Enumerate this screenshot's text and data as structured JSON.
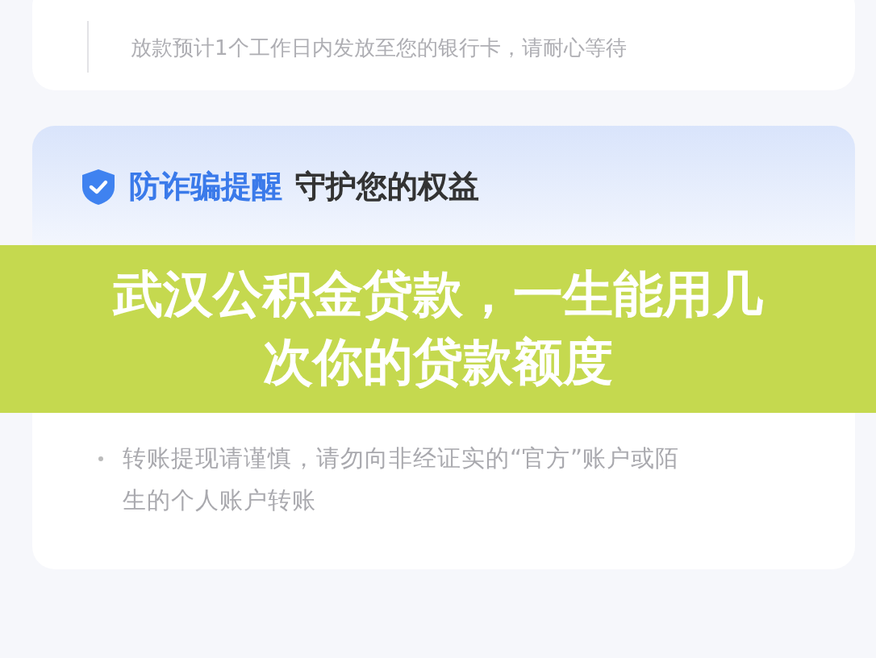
{
  "progress_card": {
    "step_description": "放款预计1个工作日内发放至您的银行卡，请耐心等待"
  },
  "safety_card": {
    "title_highlight": "防诈骗提醒",
    "title_rest": "守护您的权益",
    "tips": [
      "转账提现请谨慎，请勿向非经证实的“官方”账户或陌生的个人账户转账"
    ]
  },
  "banner": {
    "headline": "武汉公积金贷款，一生能用几次你的贷款额度"
  }
}
